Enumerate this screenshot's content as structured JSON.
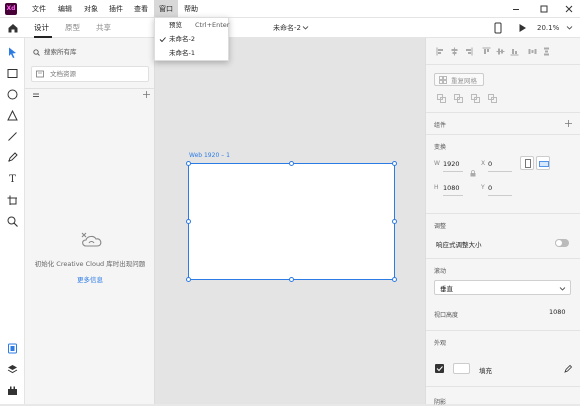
{
  "app": {
    "logo_text": "Xd"
  },
  "menubar": {
    "items": [
      "文件",
      "编辑",
      "对象",
      "插件",
      "查看",
      "窗口",
      "帮助"
    ],
    "active_index": 5
  },
  "window_menu": {
    "items": [
      {
        "label": "预览",
        "shortcut": "Ctrl+Enter",
        "checked": false
      },
      {
        "label": "未命名-2",
        "shortcut": "",
        "checked": true
      },
      {
        "label": "未命名-1",
        "shortcut": "",
        "checked": false
      }
    ]
  },
  "toolbar": {
    "tabs": [
      "设计",
      "原型",
      "共享"
    ],
    "active_tab": 0,
    "doc_title": "未命名-2",
    "zoom": "20.1%"
  },
  "library": {
    "search_placeholder": "搜索所有库",
    "doc_assets": "文档资源",
    "empty_message": "初始化 Creative Cloud 库时出现问题",
    "more_info": "更多信息"
  },
  "canvas": {
    "artboard_label": "Web 1920 – 1"
  },
  "properties": {
    "repeat_grid": "重复网格",
    "components_label": "组件",
    "transform_label": "变换",
    "w_label": "W",
    "w_value": "1920",
    "x_label": "X",
    "x_value": "0",
    "h_label": "H",
    "h_value": "1080",
    "y_label": "Y",
    "y_value": "0",
    "responsive_label": "调整",
    "responsive_resize": "响应式调整大小",
    "scroll_label": "滚动",
    "scroll_value": "垂直",
    "viewport_label": "视口高度",
    "viewport_value": "1080",
    "appearance_label": "外观",
    "fill_label": "填充",
    "shadow_label": "阴影"
  },
  "colors": {
    "accent": "#2d7be5",
    "logo_bg": "#470137",
    "logo_fg": "#ff61f6"
  }
}
